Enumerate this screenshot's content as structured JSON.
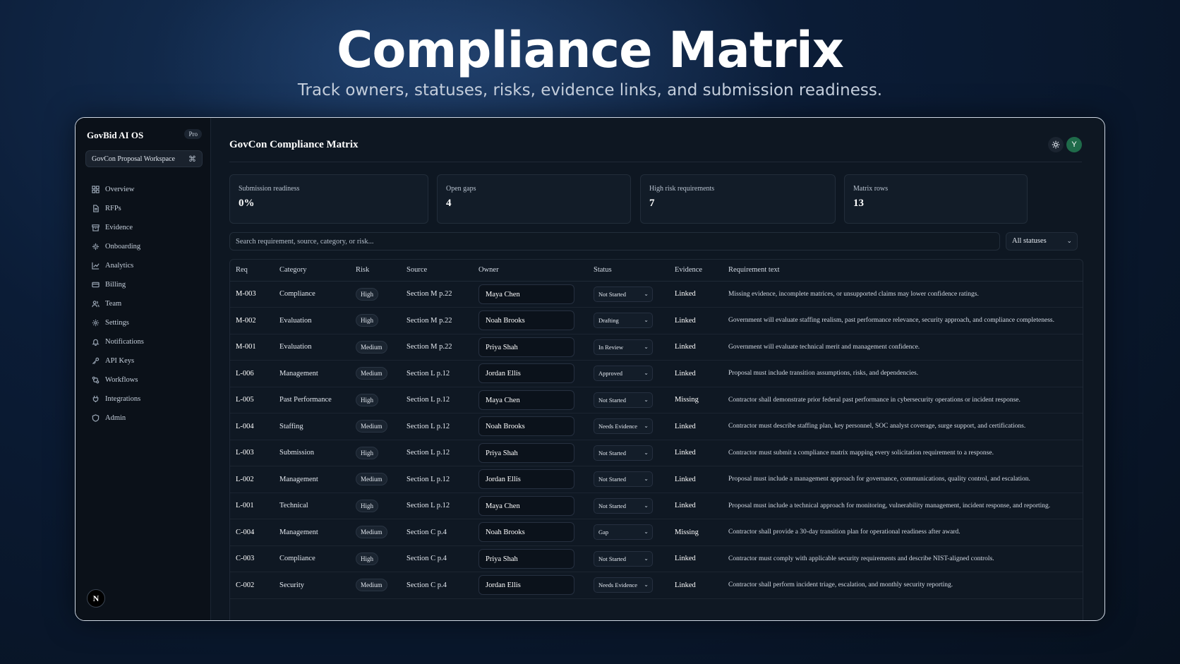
{
  "hero": {
    "title": "Compliance Matrix",
    "subtitle": "Track owners, statuses, risks, evidence links, and submission readiness."
  },
  "sidebar": {
    "brand": "GovBid AI OS",
    "plan_badge": "Pro",
    "workspace": "GovCon Proposal Workspace",
    "workspace_shortcut": "⌘",
    "items": [
      {
        "label": "Overview",
        "icon": "grid-icon"
      },
      {
        "label": "RFPs",
        "icon": "file-icon"
      },
      {
        "label": "Evidence",
        "icon": "archive-icon"
      },
      {
        "label": "Onboarding",
        "icon": "sparkle-icon"
      },
      {
        "label": "Analytics",
        "icon": "chart-icon"
      },
      {
        "label": "Billing",
        "icon": "card-icon"
      },
      {
        "label": "Team",
        "icon": "users-icon"
      },
      {
        "label": "Settings",
        "icon": "gear-icon"
      },
      {
        "label": "Notifications",
        "icon": "bell-icon"
      },
      {
        "label": "API Keys",
        "icon": "key-icon"
      },
      {
        "label": "Workflows",
        "icon": "workflow-icon"
      },
      {
        "label": "Integrations",
        "icon": "plug-icon"
      },
      {
        "label": "Admin",
        "icon": "shield-icon"
      }
    ],
    "user_initial": "N"
  },
  "main": {
    "title": "GovCon Compliance Matrix",
    "user_initial": "Y",
    "stats": [
      {
        "label": "Submission readiness",
        "value": "0%"
      },
      {
        "label": "Open gaps",
        "value": "4"
      },
      {
        "label": "High risk requirements",
        "value": "7"
      },
      {
        "label": "Matrix rows",
        "value": "13"
      }
    ],
    "search_placeholder": "Search requirement, source, category, or risk...",
    "status_filter": "All statuses",
    "columns": [
      "Req",
      "Category",
      "Risk",
      "Source",
      "Owner",
      "Status",
      "Evidence",
      "Requirement text"
    ],
    "rows": [
      {
        "req": "M-003",
        "category": "Compliance",
        "risk": "High",
        "source": "Section M p.22",
        "owner": "Maya Chen",
        "status": "Not Started",
        "evidence": "Linked",
        "text": "Missing evidence, incomplete matrices, or unsupported claims may lower confidence ratings."
      },
      {
        "req": "M-002",
        "category": "Evaluation",
        "risk": "High",
        "source": "Section M p.22",
        "owner": "Noah Brooks",
        "status": "Drafting",
        "evidence": "Linked",
        "text": "Government will evaluate staffing realism, past performance relevance, security approach, and compliance completeness."
      },
      {
        "req": "M-001",
        "category": "Evaluation",
        "risk": "Medium",
        "source": "Section M p.22",
        "owner": "Priya Shah",
        "status": "In Review",
        "evidence": "Linked",
        "text": "Government will evaluate technical merit and management confidence."
      },
      {
        "req": "L-006",
        "category": "Management",
        "risk": "Medium",
        "source": "Section L p.12",
        "owner": "Jordan Ellis",
        "status": "Approved",
        "evidence": "Linked",
        "text": "Proposal must include transition assumptions, risks, and dependencies."
      },
      {
        "req": "L-005",
        "category": "Past Performance",
        "risk": "High",
        "source": "Section L p.12",
        "owner": "Maya Chen",
        "status": "Not Started",
        "evidence": "Missing",
        "text": "Contractor shall demonstrate prior federal past performance in cybersecurity operations or incident response."
      },
      {
        "req": "L-004",
        "category": "Staffing",
        "risk": "Medium",
        "source": "Section L p.12",
        "owner": "Noah Brooks",
        "status": "Needs Evidence",
        "evidence": "Linked",
        "text": "Contractor must describe staffing plan, key personnel, SOC analyst coverage, surge support, and certifications."
      },
      {
        "req": "L-003",
        "category": "Submission",
        "risk": "High",
        "source": "Section L p.12",
        "owner": "Priya Shah",
        "status": "Not Started",
        "evidence": "Linked",
        "text": "Contractor must submit a compliance matrix mapping every solicitation requirement to a response."
      },
      {
        "req": "L-002",
        "category": "Management",
        "risk": "Medium",
        "source": "Section L p.12",
        "owner": "Jordan Ellis",
        "status": "Not Started",
        "evidence": "Linked",
        "text": "Proposal must include a management approach for governance, communications, quality control, and escalation."
      },
      {
        "req": "L-001",
        "category": "Technical",
        "risk": "High",
        "source": "Section L p.12",
        "owner": "Maya Chen",
        "status": "Not Started",
        "evidence": "Linked",
        "text": "Proposal must include a technical approach for monitoring, vulnerability management, incident response, and reporting."
      },
      {
        "req": "C-004",
        "category": "Management",
        "risk": "Medium",
        "source": "Section C p.4",
        "owner": "Noah Brooks",
        "status": "Gap",
        "evidence": "Missing",
        "text": "Contractor shall provide a 30-day transition plan for operational readiness after award."
      },
      {
        "req": "C-003",
        "category": "Compliance",
        "risk": "High",
        "source": "Section C p.4",
        "owner": "Priya Shah",
        "status": "Not Started",
        "evidence": "Linked",
        "text": "Contractor must comply with applicable security requirements and describe NIST-aligned controls."
      },
      {
        "req": "C-002",
        "category": "Security",
        "risk": "Medium",
        "source": "Section C p.4",
        "owner": "Jordan Ellis",
        "status": "Needs Evidence",
        "evidence": "Linked",
        "text": "Contractor shall perform incident triage, escalation, and monthly security reporting."
      }
    ]
  }
}
